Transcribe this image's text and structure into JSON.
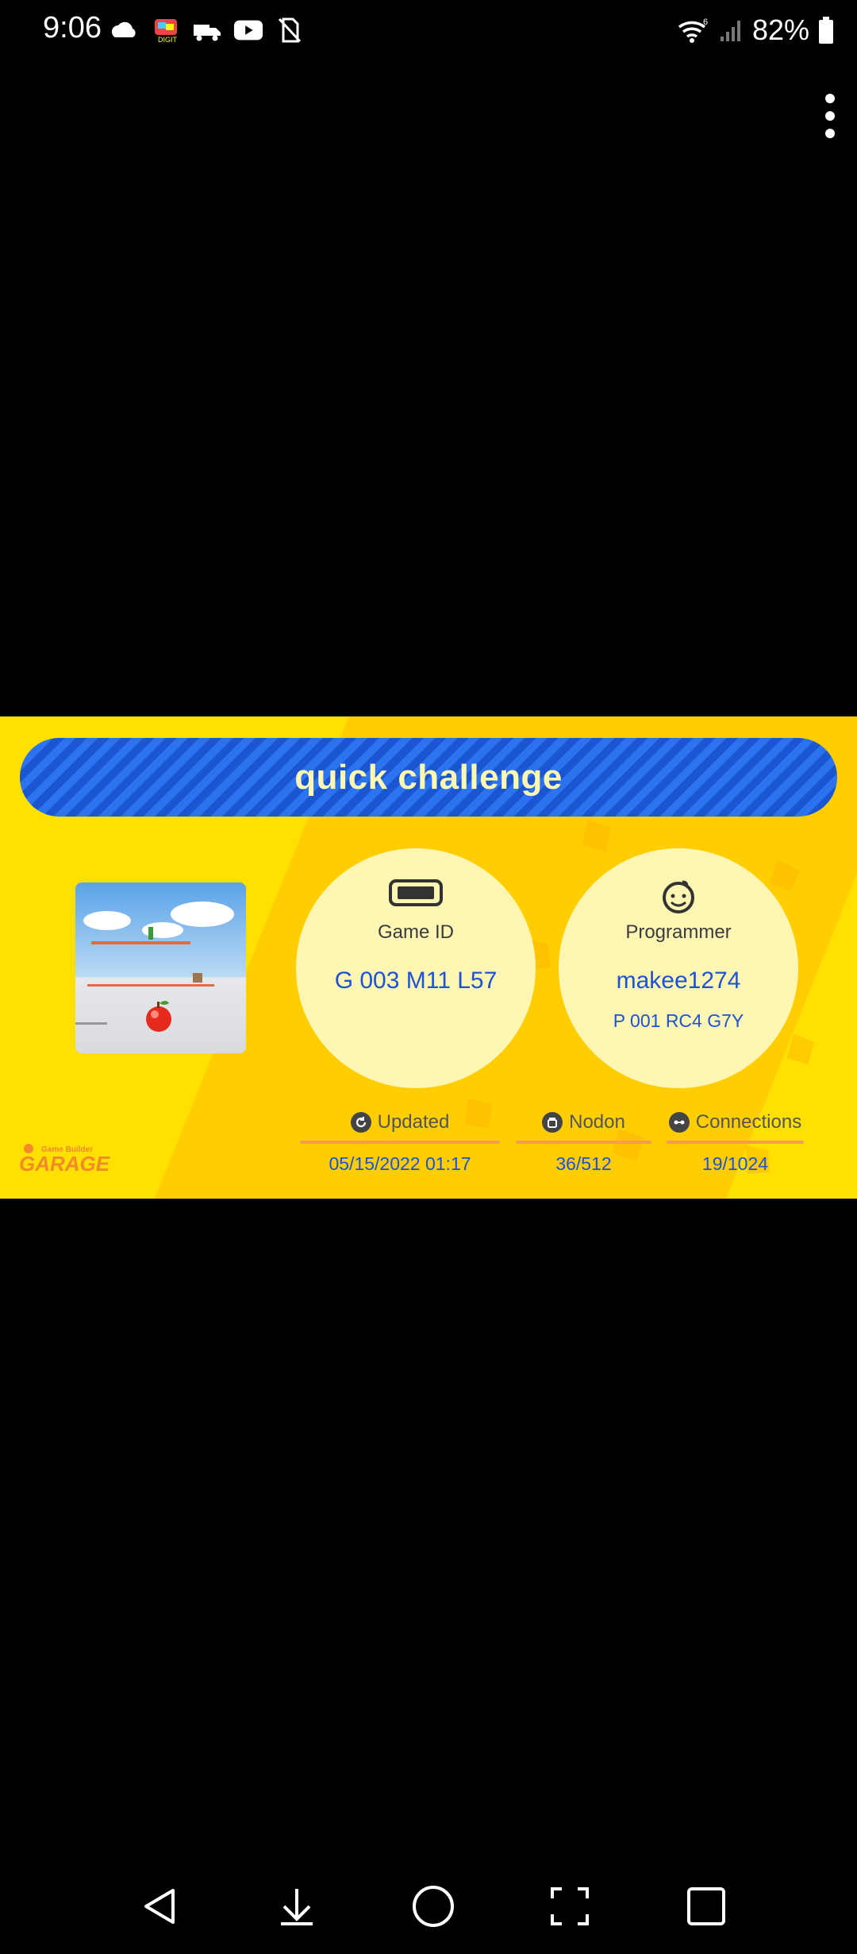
{
  "status_bar": {
    "time": "9:06",
    "battery": "82%",
    "wifi_badge": "6",
    "icons_left": [
      "weather-icon",
      "app-badge-icon",
      "delivery-icon",
      "youtube-icon",
      "no-sim-icon"
    ]
  },
  "card": {
    "title": "quick challenge",
    "game_id": {
      "label": "Game ID",
      "value": "G 003 M11 L57"
    },
    "programmer": {
      "label": "Programmer",
      "value": "makee1274",
      "id": "P 001 RC4 G7Y"
    },
    "stats": {
      "updated": {
        "label": "Updated",
        "value": "05/15/2022 01:17"
      },
      "nodon": {
        "label": "Nodon",
        "value": "36/512"
      },
      "connections": {
        "label": "Connections",
        "value": "19/1024"
      }
    },
    "logo": "Game Builder GARAGE"
  },
  "colors": {
    "card_bg": "#ffe000",
    "banner": "#1f63e6",
    "bubble": "#fff6b3",
    "value_text": "#1c53d6",
    "underline": "#f59a5b"
  }
}
